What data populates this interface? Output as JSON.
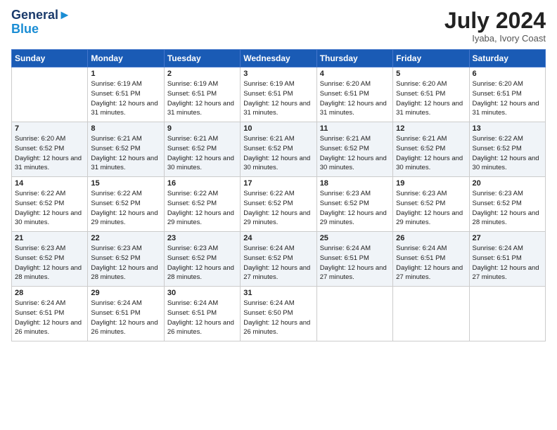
{
  "header": {
    "logo_line1": "General",
    "logo_line2": "Blue",
    "month_title": "July 2024",
    "location": "Iyaba, Ivory Coast"
  },
  "days_of_week": [
    "Sunday",
    "Monday",
    "Tuesday",
    "Wednesday",
    "Thursday",
    "Friday",
    "Saturday"
  ],
  "weeks": [
    [
      {
        "num": "",
        "sunrise": "",
        "sunset": "",
        "daylight": ""
      },
      {
        "num": "1",
        "sunrise": "Sunrise: 6:19 AM",
        "sunset": "Sunset: 6:51 PM",
        "daylight": "Daylight: 12 hours and 31 minutes."
      },
      {
        "num": "2",
        "sunrise": "Sunrise: 6:19 AM",
        "sunset": "Sunset: 6:51 PM",
        "daylight": "Daylight: 12 hours and 31 minutes."
      },
      {
        "num": "3",
        "sunrise": "Sunrise: 6:19 AM",
        "sunset": "Sunset: 6:51 PM",
        "daylight": "Daylight: 12 hours and 31 minutes."
      },
      {
        "num": "4",
        "sunrise": "Sunrise: 6:20 AM",
        "sunset": "Sunset: 6:51 PM",
        "daylight": "Daylight: 12 hours and 31 minutes."
      },
      {
        "num": "5",
        "sunrise": "Sunrise: 6:20 AM",
        "sunset": "Sunset: 6:51 PM",
        "daylight": "Daylight: 12 hours and 31 minutes."
      },
      {
        "num": "6",
        "sunrise": "Sunrise: 6:20 AM",
        "sunset": "Sunset: 6:51 PM",
        "daylight": "Daylight: 12 hours and 31 minutes."
      }
    ],
    [
      {
        "num": "7",
        "sunrise": "Sunrise: 6:20 AM",
        "sunset": "Sunset: 6:52 PM",
        "daylight": "Daylight: 12 hours and 31 minutes."
      },
      {
        "num": "8",
        "sunrise": "Sunrise: 6:21 AM",
        "sunset": "Sunset: 6:52 PM",
        "daylight": "Daylight: 12 hours and 31 minutes."
      },
      {
        "num": "9",
        "sunrise": "Sunrise: 6:21 AM",
        "sunset": "Sunset: 6:52 PM",
        "daylight": "Daylight: 12 hours and 30 minutes."
      },
      {
        "num": "10",
        "sunrise": "Sunrise: 6:21 AM",
        "sunset": "Sunset: 6:52 PM",
        "daylight": "Daylight: 12 hours and 30 minutes."
      },
      {
        "num": "11",
        "sunrise": "Sunrise: 6:21 AM",
        "sunset": "Sunset: 6:52 PM",
        "daylight": "Daylight: 12 hours and 30 minutes."
      },
      {
        "num": "12",
        "sunrise": "Sunrise: 6:21 AM",
        "sunset": "Sunset: 6:52 PM",
        "daylight": "Daylight: 12 hours and 30 minutes."
      },
      {
        "num": "13",
        "sunrise": "Sunrise: 6:22 AM",
        "sunset": "Sunset: 6:52 PM",
        "daylight": "Daylight: 12 hours and 30 minutes."
      }
    ],
    [
      {
        "num": "14",
        "sunrise": "Sunrise: 6:22 AM",
        "sunset": "Sunset: 6:52 PM",
        "daylight": "Daylight: 12 hours and 30 minutes."
      },
      {
        "num": "15",
        "sunrise": "Sunrise: 6:22 AM",
        "sunset": "Sunset: 6:52 PM",
        "daylight": "Daylight: 12 hours and 29 minutes."
      },
      {
        "num": "16",
        "sunrise": "Sunrise: 6:22 AM",
        "sunset": "Sunset: 6:52 PM",
        "daylight": "Daylight: 12 hours and 29 minutes."
      },
      {
        "num": "17",
        "sunrise": "Sunrise: 6:22 AM",
        "sunset": "Sunset: 6:52 PM",
        "daylight": "Daylight: 12 hours and 29 minutes."
      },
      {
        "num": "18",
        "sunrise": "Sunrise: 6:23 AM",
        "sunset": "Sunset: 6:52 PM",
        "daylight": "Daylight: 12 hours and 29 minutes."
      },
      {
        "num": "19",
        "sunrise": "Sunrise: 6:23 AM",
        "sunset": "Sunset: 6:52 PM",
        "daylight": "Daylight: 12 hours and 29 minutes."
      },
      {
        "num": "20",
        "sunrise": "Sunrise: 6:23 AM",
        "sunset": "Sunset: 6:52 PM",
        "daylight": "Daylight: 12 hours and 28 minutes."
      }
    ],
    [
      {
        "num": "21",
        "sunrise": "Sunrise: 6:23 AM",
        "sunset": "Sunset: 6:52 PM",
        "daylight": "Daylight: 12 hours and 28 minutes."
      },
      {
        "num": "22",
        "sunrise": "Sunrise: 6:23 AM",
        "sunset": "Sunset: 6:52 PM",
        "daylight": "Daylight: 12 hours and 28 minutes."
      },
      {
        "num": "23",
        "sunrise": "Sunrise: 6:23 AM",
        "sunset": "Sunset: 6:52 PM",
        "daylight": "Daylight: 12 hours and 28 minutes."
      },
      {
        "num": "24",
        "sunrise": "Sunrise: 6:24 AM",
        "sunset": "Sunset: 6:52 PM",
        "daylight": "Daylight: 12 hours and 27 minutes."
      },
      {
        "num": "25",
        "sunrise": "Sunrise: 6:24 AM",
        "sunset": "Sunset: 6:51 PM",
        "daylight": "Daylight: 12 hours and 27 minutes."
      },
      {
        "num": "26",
        "sunrise": "Sunrise: 6:24 AM",
        "sunset": "Sunset: 6:51 PM",
        "daylight": "Daylight: 12 hours and 27 minutes."
      },
      {
        "num": "27",
        "sunrise": "Sunrise: 6:24 AM",
        "sunset": "Sunset: 6:51 PM",
        "daylight": "Daylight: 12 hours and 27 minutes."
      }
    ],
    [
      {
        "num": "28",
        "sunrise": "Sunrise: 6:24 AM",
        "sunset": "Sunset: 6:51 PM",
        "daylight": "Daylight: 12 hours and 26 minutes."
      },
      {
        "num": "29",
        "sunrise": "Sunrise: 6:24 AM",
        "sunset": "Sunset: 6:51 PM",
        "daylight": "Daylight: 12 hours and 26 minutes."
      },
      {
        "num": "30",
        "sunrise": "Sunrise: 6:24 AM",
        "sunset": "Sunset: 6:51 PM",
        "daylight": "Daylight: 12 hours and 26 minutes."
      },
      {
        "num": "31",
        "sunrise": "Sunrise: 6:24 AM",
        "sunset": "Sunset: 6:50 PM",
        "daylight": "Daylight: 12 hours and 26 minutes."
      },
      {
        "num": "",
        "sunrise": "",
        "sunset": "",
        "daylight": ""
      },
      {
        "num": "",
        "sunrise": "",
        "sunset": "",
        "daylight": ""
      },
      {
        "num": "",
        "sunrise": "",
        "sunset": "",
        "daylight": ""
      }
    ]
  ]
}
